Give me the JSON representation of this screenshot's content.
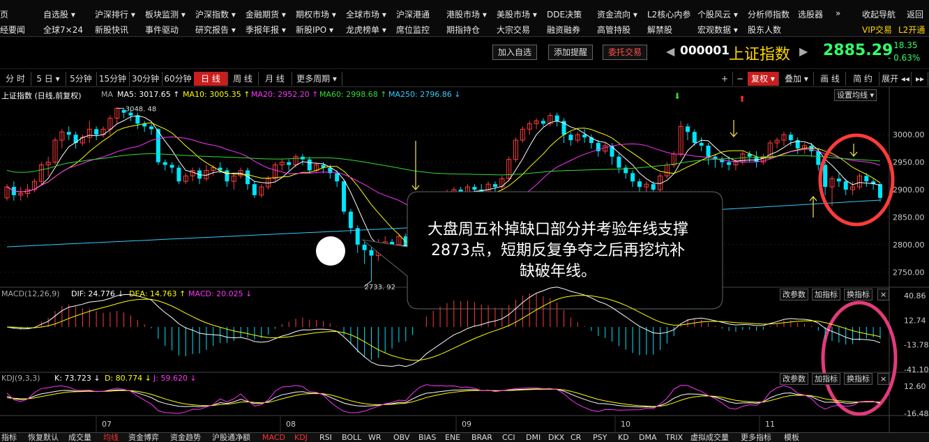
{
  "nav": {
    "row1": [
      "页",
      "自选股 ▾",
      "沪深排行 ▾",
      "板块监测 ▾",
      "沪深指数 ▾",
      "金融期货 ▾",
      "期权市场 ▾",
      "全球市场 ▾",
      "沪深港通",
      "港股市场 ▾",
      "美股市场 ▾",
      "DDE决策",
      "资金流向 ▾",
      "L2核心内参",
      "个股风云 ▾",
      "分析师指数",
      "选股器",
      "»",
      "收起导航",
      "返回"
    ],
    "row2": [
      "经要闻",
      "全球7×24",
      "新股快讯",
      "事件驱动",
      "研究报告 ▾",
      "季报年报 ▾",
      "新股IPO ▾",
      "龙虎榜单 ▾",
      "席位监控",
      "期指持仓",
      "大宗交易",
      "融资融券",
      "高管持股",
      "解禁股",
      "宏观数据 ▾",
      "股东人数",
      "VIP交易",
      "L2开通"
    ]
  },
  "quote": {
    "add_watch": "加入自选",
    "add_alert": "添加提醒",
    "order": "委托交易",
    "code": "000001",
    "name": "上证指数",
    "price": "2885.29",
    "change": "- 18.35",
    "change_pct": "- 0.63%"
  },
  "periods": [
    "分 时",
    "5 日 ▾",
    "5分钟",
    "15分钟",
    "30分钟",
    "60分钟",
    "日 线",
    "周 线",
    "月 线",
    "更多周期 ▾"
  ],
  "active_period": "日 线",
  "right_tools": [
    "+",
    "−",
    "复权 ▾",
    "叠加 ▾",
    "画 线",
    "简 约",
    "展开 ◂◂",
    "▸▸"
  ],
  "main_legend": {
    "title": "上证指数 (日线,前复权)",
    "ma": "MA",
    "ma5": "MA5: 3017.65 ↑",
    "ma10": "MA10: 3005.35 ↑",
    "ma20": "MA20: 2952.20 ↑",
    "ma60": "MA60: 2998.68 ↑",
    "ma250": "MA250: 2796.86 ↓",
    "setting": "设置均线 ▾"
  },
  "annotations": {
    "high": "3048. 48",
    "low": "2733. 92",
    "callout": "大盘周五补掉缺口部分并考验年线支撑2873点，短期反复争夺之后再挖坑补缺破年线。"
  },
  "macd_legend": {
    "name": "MACD(12,26,9)",
    "dif": "DIF: 24.776 ↓",
    "dea": "DEA: 14.763 ↑",
    "macd": "MACD: 20.025 ↓"
  },
  "kdj_legend": {
    "name": "KDJ(9,3,3)",
    "k": "K: 73.723 ↓",
    "d": "D: 80.774 ↓",
    "j": "J: 59.620 ↓"
  },
  "panel_buttons": [
    "改参数",
    "加指标",
    "换指标",
    "×"
  ],
  "x_labels": [
    "07",
    "08",
    "09",
    "10",
    "11"
  ],
  "bottom_tabs": [
    "指标",
    "恢复默认",
    "成交量",
    "均线",
    "资金博弈",
    "资金趋势",
    "沪股通净额",
    "MACD",
    "KDJ",
    "RSI",
    "BOLL",
    "WR",
    "OBV",
    "BIAS",
    "ENE",
    "BRAR",
    "CCI",
    "DMI",
    "DKX",
    "CR",
    "PSY",
    "KD",
    "DMA",
    "TRIX",
    "虚拟成交量",
    "更多指标",
    "模板"
  ],
  "colors": {
    "up": "#ff3c3c",
    "down": "#00e5ff",
    "ma5": "#ffffff",
    "ma10": "#ffff00",
    "ma20": "#ff33ff",
    "ma60": "#33dd33",
    "ma250": "#33ccff",
    "dif": "#ffffff",
    "dea": "#ffff00",
    "macd": "#ff33ff",
    "price_up": "#33ff66"
  },
  "chart_data": {
    "type": "candlestick",
    "y_ticks": [
      3000,
      2950,
      2900,
      2850,
      2800,
      2750
    ],
    "y_tick_labels": [
      "3000.00",
      "2950.00",
      "2900.00",
      "2850.00",
      "2800.00",
      "2750.00"
    ],
    "ylim": [
      2725,
      3070
    ],
    "candles": [
      [
        2885,
        2905,
        2880,
        2910
      ],
      [
        2905,
        2890,
        2880,
        2915
      ],
      [
        2890,
        2893,
        2880,
        2905
      ],
      [
        2893,
        2900,
        2885,
        2910
      ],
      [
        2900,
        2915,
        2895,
        2920
      ],
      [
        2915,
        2945,
        2910,
        2950
      ],
      [
        2945,
        2950,
        2925,
        2960
      ],
      [
        2950,
        2990,
        2945,
        2995
      ],
      [
        2990,
        3005,
        2975,
        3010
      ],
      [
        3005,
        3000,
        2990,
        3015
      ],
      [
        3000,
        2985,
        2975,
        3005
      ],
      [
        2985,
        2995,
        2980,
        3000
      ],
      [
        2995,
        3010,
        2985,
        3025
      ],
      [
        3010,
        3000,
        2990,
        3015
      ],
      [
        3000,
        3010,
        2995,
        3015
      ],
      [
        3010,
        3030,
        3000,
        3035
      ],
      [
        3030,
        3048,
        3020,
        3050
      ],
      [
        3045,
        3040,
        3030,
        3048
      ],
      [
        3040,
        3035,
        3025,
        3045
      ],
      [
        3035,
        3020,
        3010,
        3040
      ],
      [
        3020,
        3015,
        3005,
        3025
      ],
      [
        3015,
        3010,
        3000,
        3020
      ],
      [
        3010,
        2950,
        2945,
        3012
      ],
      [
        2950,
        2945,
        2935,
        2955
      ],
      [
        2945,
        2940,
        2930,
        2950
      ],
      [
        2940,
        2915,
        2910,
        2945
      ],
      [
        2915,
        2925,
        2910,
        2930
      ],
      [
        2925,
        2935,
        2915,
        2940
      ],
      [
        2935,
        2920,
        2910,
        2940
      ],
      [
        2920,
        2935,
        2915,
        2945
      ],
      [
        2935,
        2940,
        2925,
        2945
      ],
      [
        2940,
        2935,
        2930,
        2950
      ],
      [
        2935,
        2915,
        2905,
        2940
      ],
      [
        2915,
        2925,
        2900,
        2930
      ],
      [
        2925,
        2935,
        2920,
        2940
      ],
      [
        2935,
        2910,
        2900,
        2940
      ],
      [
        2910,
        2890,
        2885,
        2915
      ],
      [
        2890,
        2905,
        2885,
        2910
      ],
      [
        2905,
        2920,
        2900,
        2925
      ],
      [
        2920,
        2945,
        2915,
        2950
      ],
      [
        2945,
        2950,
        2935,
        2955
      ],
      [
        2950,
        2945,
        2935,
        2955
      ],
      [
        2945,
        2960,
        2940,
        2965
      ],
      [
        2960,
        2955,
        2945,
        2965
      ],
      [
        2955,
        2935,
        2930,
        2960
      ],
      [
        2935,
        2945,
        2930,
        2950
      ],
      [
        2945,
        2940,
        2930,
        2950
      ],
      [
        2940,
        2930,
        2920,
        2945
      ],
      [
        2930,
        2915,
        2905,
        2935
      ],
      [
        2915,
        2860,
        2855,
        2918
      ],
      [
        2860,
        2830,
        2820,
        2865
      ],
      [
        2830,
        2800,
        2785,
        2835
      ],
      [
        2800,
        2790,
        2765,
        2805
      ],
      [
        2790,
        2780,
        2734,
        2795
      ],
      [
        2780,
        2790,
        2770,
        2810
      ],
      [
        2790,
        2805,
        2785,
        2815
      ],
      [
        2805,
        2800,
        2790,
        2810
      ],
      [
        2800,
        2815,
        2795,
        2820
      ],
      [
        2815,
        2780,
        2760,
        2820
      ],
      [
        2780,
        2815,
        2775,
        2820
      ],
      [
        2815,
        2840,
        2810,
        2845
      ],
      [
        2840,
        2880,
        2835,
        2885
      ],
      [
        2880,
        2870,
        2860,
        2890
      ],
      [
        2870,
        2880,
        2865,
        2890
      ],
      [
        2880,
        2890,
        2875,
        2900
      ],
      [
        2890,
        2900,
        2880,
        2905
      ],
      [
        2900,
        2890,
        2875,
        2905
      ],
      [
        2890,
        2905,
        2885,
        2910
      ],
      [
        2905,
        2900,
        2890,
        2910
      ],
      [
        2900,
        2895,
        2885,
        2910
      ],
      [
        2895,
        2910,
        2890,
        2915
      ],
      [
        2910,
        2905,
        2895,
        2915
      ],
      [
        2905,
        2920,
        2900,
        2925
      ],
      [
        2920,
        2955,
        2915,
        2960
      ],
      [
        2955,
        2990,
        2950,
        2995
      ],
      [
        2990,
        3010,
        2985,
        3015
      ],
      [
        3010,
        3020,
        3000,
        3025
      ],
      [
        3020,
        3025,
        3010,
        3030
      ],
      [
        3025,
        3020,
        3015,
        3030
      ],
      [
        3020,
        3035,
        3015,
        3040
      ],
      [
        3035,
        3025,
        3015,
        3040
      ],
      [
        3025,
        3000,
        2985,
        3030
      ],
      [
        3000,
        2990,
        2980,
        3005
      ],
      [
        2990,
        3000,
        2985,
        3005
      ],
      [
        3000,
        2995,
        2985,
        3010
      ],
      [
        2995,
        2985,
        2975,
        3000
      ],
      [
        2985,
        2970,
        2960,
        2990
      ],
      [
        2970,
        2980,
        2965,
        2985
      ],
      [
        2980,
        2960,
        2945,
        2985
      ],
      [
        2960,
        2940,
        2930,
        2965
      ],
      [
        2940,
        2930,
        2920,
        2945
      ],
      [
        2930,
        2915,
        2905,
        2935
      ],
      [
        2915,
        2905,
        2895,
        2920
      ],
      [
        2905,
        2910,
        2895,
        2915
      ],
      [
        2910,
        2900,
        2892,
        2915
      ],
      [
        2900,
        2925,
        2895,
        2930
      ],
      [
        2925,
        2945,
        2920,
        2950
      ],
      [
        2945,
        2965,
        2940,
        2970
      ],
      [
        2965,
        3015,
        2960,
        3025
      ],
      [
        3015,
        3005,
        2990,
        3020
      ],
      [
        3005,
        2985,
        2980,
        3010
      ],
      [
        2985,
        2980,
        2970,
        2995
      ],
      [
        2980,
        2960,
        2945,
        2985
      ],
      [
        2960,
        2955,
        2940,
        2965
      ],
      [
        2955,
        2950,
        2940,
        2960
      ],
      [
        2950,
        2945,
        2935,
        2960
      ],
      [
        2945,
        2950,
        2935,
        2955
      ],
      [
        2950,
        2965,
        2945,
        2970
      ],
      [
        2965,
        2960,
        2950,
        2970
      ],
      [
        2960,
        2950,
        2940,
        2970
      ],
      [
        2950,
        2960,
        2945,
        2965
      ],
      [
        2960,
        2985,
        2955,
        2990
      ],
      [
        2985,
        2990,
        2975,
        2995
      ],
      [
        2990,
        3000,
        2980,
        3005
      ],
      [
        3000,
        2990,
        2980,
        3005
      ],
      [
        2990,
        2975,
        2965,
        2995
      ],
      [
        2975,
        2980,
        2965,
        2985
      ],
      [
        2980,
        2970,
        2960,
        2985
      ],
      [
        2970,
        2945,
        2935,
        2975
      ],
      [
        2945,
        2905,
        2890,
        2950
      ],
      [
        2905,
        2920,
        2870,
        2925
      ],
      [
        2920,
        2915,
        2905,
        2930
      ],
      [
        2915,
        2900,
        2890,
        2920
      ],
      [
        2900,
        2905,
        2890,
        2915
      ],
      [
        2905,
        2925,
        2900,
        2930
      ],
      [
        2925,
        2915,
        2905,
        2930
      ],
      [
        2915,
        2910,
        2900,
        2920
      ],
      [
        2910,
        2885,
        2878,
        2912
      ]
    ],
    "x_labels": [
      "07",
      "08",
      "09",
      "10",
      "11"
    ],
    "macd_ticks": [
      "40.86",
      "12.74",
      "-13.78",
      "-41.10"
    ],
    "kdj_ticks": [
      "12.60",
      "-16.48"
    ]
  }
}
